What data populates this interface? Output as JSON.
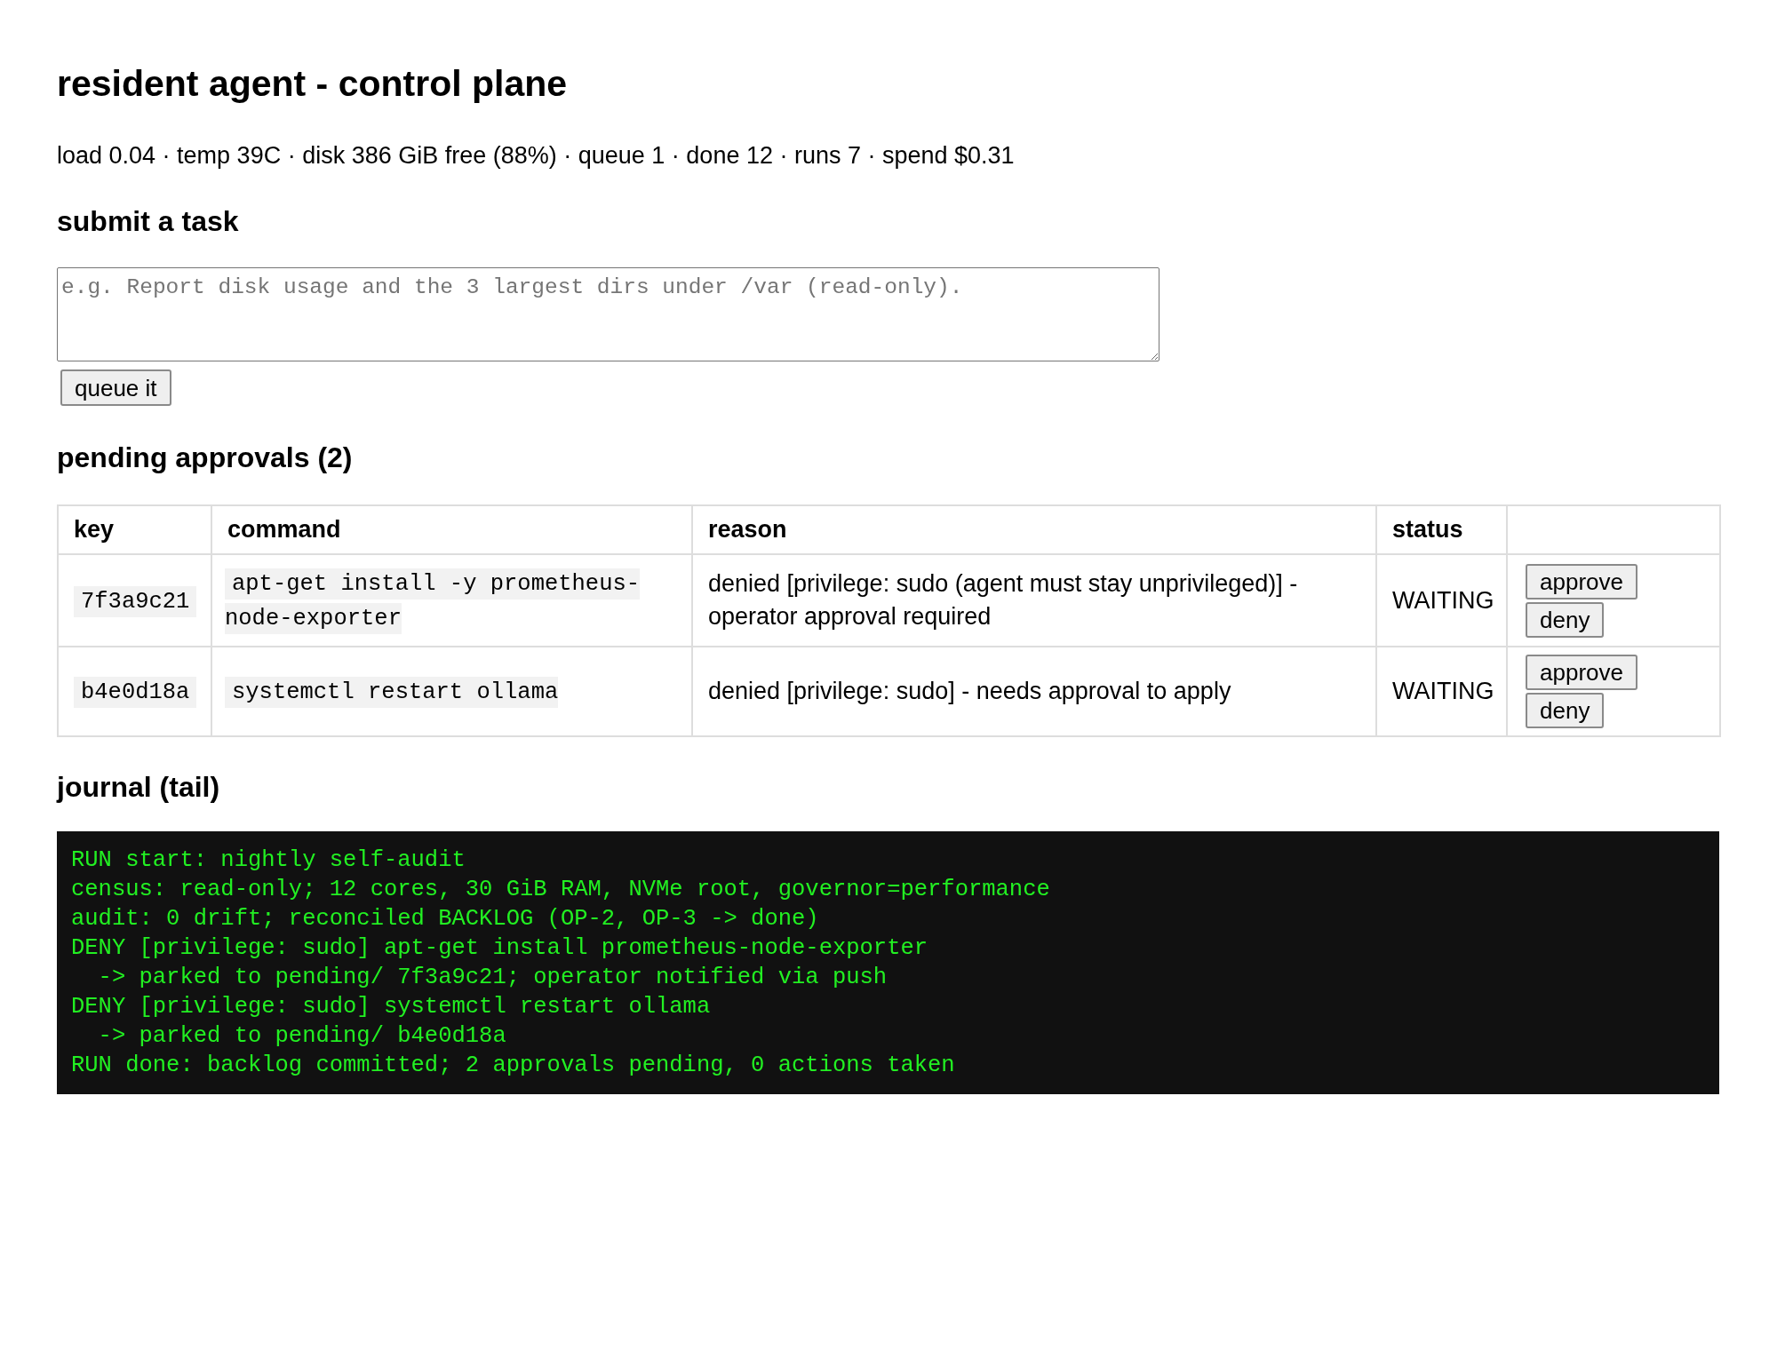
{
  "page": {
    "title": "resident agent - control plane",
    "stats": "load 0.04 · temp 39C · disk 386 GiB free (88%) · queue 1 · done 12 · runs 7 · spend $0.31"
  },
  "submit": {
    "heading": "submit a task",
    "task_input": {
      "placeholder": "e.g. Report disk usage and the 3 largest dirs under /var (read-only)."
    },
    "button": "queue it"
  },
  "approvals": {
    "heading": "pending approvals (2)",
    "columns": [
      "key",
      "command",
      "reason",
      "status"
    ],
    "rows": [
      {
        "key": "7f3a9c21",
        "command": "apt-get install -y prometheus-node-exporter",
        "reason": "denied [privilege: sudo (agent must stay unprivileged)] - operator approval required",
        "status": "WAITING",
        "actions": [
          "approve",
          "deny"
        ]
      },
      {
        "key": "b4e0d18a",
        "command": "systemctl restart ollama",
        "reason": "denied [privilege: sudo] - needs approval to apply",
        "status": "WAITING",
        "actions": [
          "approve",
          "deny"
        ]
      }
    ]
  },
  "journal": {
    "heading": "journal (tail)",
    "lines": [
      "RUN start: nightly self-audit",
      "census: read-only; 12 cores, 30 GiB RAM, NVMe root, governor=performance",
      "audit: 0 drift; reconciled BACKLOG (OP-2, OP-3 -> done)",
      "DENY [privilege: sudo] apt-get install prometheus-node-exporter",
      "  -> parked to pending/ 7f3a9c21; operator notified via push",
      "DENY [privilege: sudo] systemctl restart ollama",
      "  -> parked to pending/ b4e0d18a",
      "RUN done: backlog committed; 2 approvals pending, 0 actions taken"
    ]
  }
}
